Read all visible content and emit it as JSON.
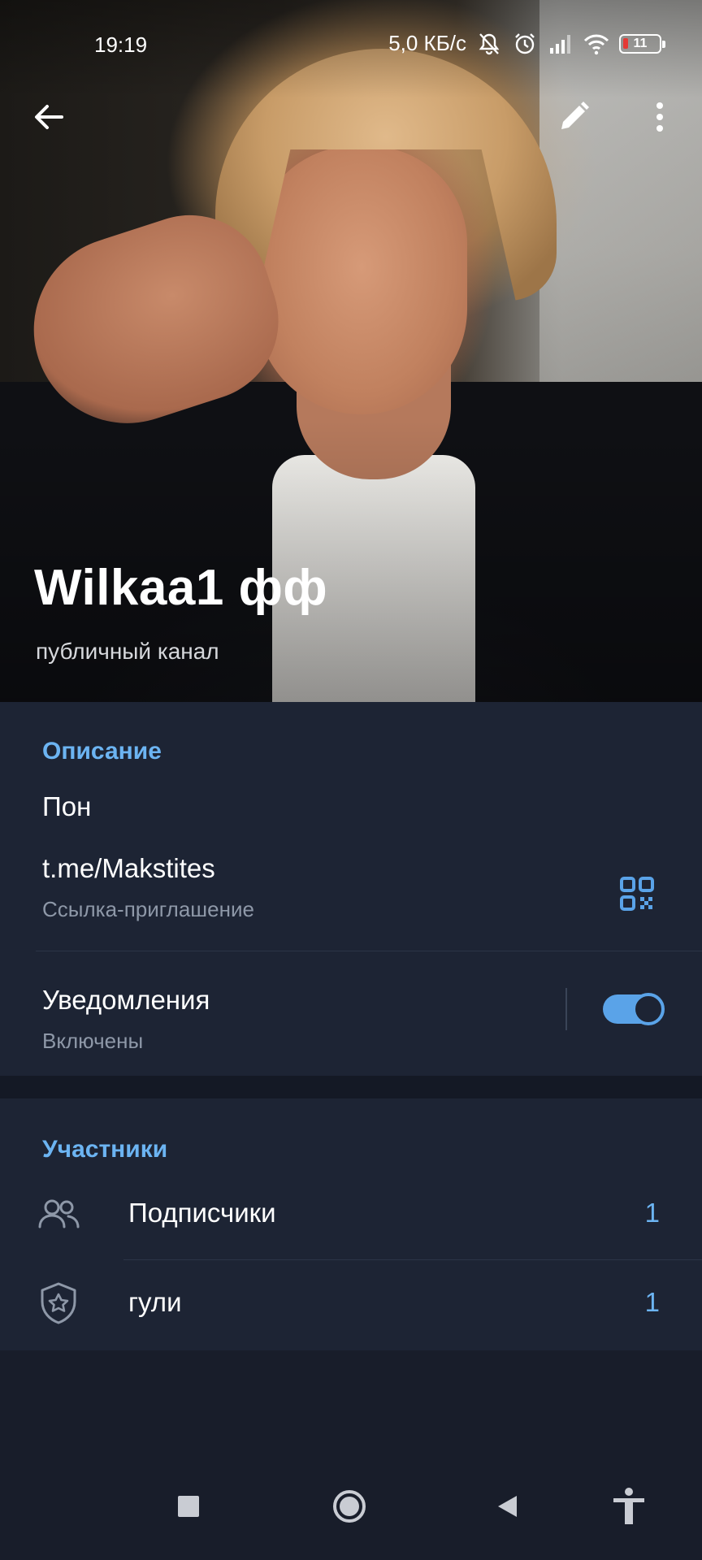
{
  "status_bar": {
    "time": "19:19",
    "network_speed": "5,0 КБ/с",
    "battery_level": "11",
    "icons": [
      "bell-muted-icon",
      "alarm-icon",
      "signal-icon",
      "wifi-icon",
      "battery-icon"
    ]
  },
  "header": {
    "title": "Wilkaa1 фф",
    "subtitle": "публичный канал",
    "icons": [
      "back-arrow-icon",
      "pencil-icon",
      "more-vertical-icon"
    ]
  },
  "info": {
    "section_title": "Описание",
    "description": "Пон",
    "link": "t.me/Makstites",
    "link_caption": "Ссылка-приглашение",
    "notifications_label": "Уведомления",
    "notifications_state": "Включены",
    "notifications_on": true
  },
  "members": {
    "section_title": "Участники",
    "items": [
      {
        "label": "Подписчики",
        "count": "1",
        "icon": "people-icon"
      },
      {
        "label": "гули",
        "count": "1",
        "icon": "shield-star-icon"
      }
    ]
  },
  "colors": {
    "accent": "#6cb4f2",
    "toggle": "#5aa3e8",
    "background": "#181d2a",
    "section": "#1d2434",
    "muted_text": "#8e98a8"
  },
  "navbar": {
    "icons": [
      "recents-square-icon",
      "home-circle-icon",
      "back-triangle-icon",
      "accessibility-icon"
    ]
  }
}
